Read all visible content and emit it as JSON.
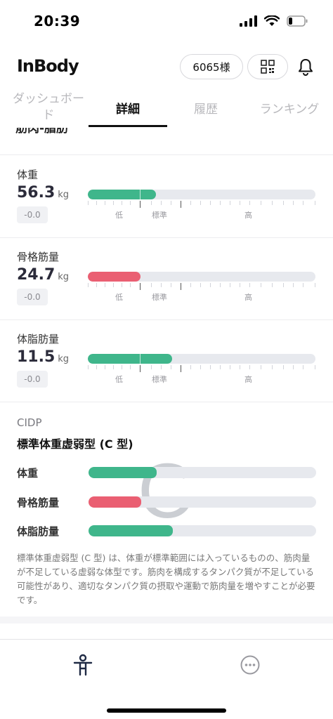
{
  "status_bar": {
    "time": "20:39"
  },
  "header": {
    "logo": "InBody",
    "user_pill": "6065様"
  },
  "tabs": [
    {
      "label": "ダッシュボード",
      "active": false
    },
    {
      "label": "詳細",
      "active": true
    },
    {
      "label": "履歴",
      "active": false
    },
    {
      "label": "ランキング",
      "active": false
    }
  ],
  "section": {
    "title": "筋肉-脂肪"
  },
  "scale": {
    "low": "低",
    "standard": "標準",
    "high": "高"
  },
  "metrics": [
    {
      "label": "体重",
      "value": "56.3",
      "unit": "kg",
      "delta": "-0.0",
      "fill_fraction": 0.3,
      "color": "#3fb68b"
    },
    {
      "label": "骨格筋量",
      "value": "24.7",
      "unit": "kg",
      "delta": "-0.0",
      "fill_fraction": 0.23,
      "color": "#ea5f72"
    },
    {
      "label": "体脂肪量",
      "value": "11.5",
      "unit": "kg",
      "delta": "-0.0",
      "fill_fraction": 0.37,
      "color": "#3fb68b"
    }
  ],
  "cidp": {
    "heading": "CIDP",
    "type_label": "標準体重虚弱型 (C 型)",
    "letter": "C",
    "rows": [
      {
        "label": "体重",
        "fill_fraction": 0.3,
        "color": "#3fb68b"
      },
      {
        "label": "骨格筋量",
        "fill_fraction": 0.23,
        "color": "#ea5f72"
      },
      {
        "label": "体脂肪量",
        "fill_fraction": 0.37,
        "color": "#3fb68b"
      }
    ],
    "description": "標準体重虚弱型 (C 型) は、体重が標準範囲には入っているものの、筋肉量が不足している虚弱な体型です。筋肉を構成するタンパク質が不足している可能性があり、適切なタンパク質の摂取や運動で筋肉量を増やすことが必要です。"
  },
  "bottom_nav": [
    {
      "icon": "body-icon"
    },
    {
      "icon": "more-icon"
    }
  ]
}
